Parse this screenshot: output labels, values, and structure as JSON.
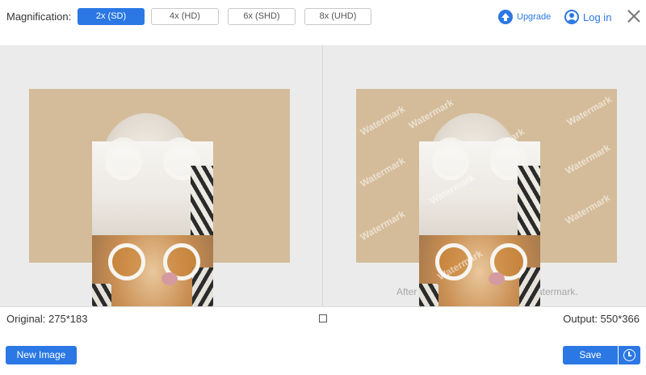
{
  "toolbar": {
    "magnification_label": "Magnification:",
    "options": [
      {
        "label": "2x (SD)",
        "selected": true
      },
      {
        "label": "4x (HD)",
        "selected": false
      },
      {
        "label": "6x (SHD)",
        "selected": false
      },
      {
        "label": "8x (UHD)",
        "selected": false
      }
    ],
    "upgrade_label": "Upgrade",
    "login_label": "Log in"
  },
  "preview": {
    "watermark_text": "Watermark",
    "caption_left": "After",
    "caption_right": "atermark."
  },
  "info": {
    "original": "Original: 275*183",
    "output": "Output: 550*366"
  },
  "bottom": {
    "new_image_label": "New Image",
    "save_label": "Save"
  },
  "colors": {
    "accent": "#2b78e4",
    "preview_background": "#ebebeb",
    "photo_background": "#d4bc9a"
  },
  "icons": {
    "upgrade": "upgrade-arrow-icon",
    "login": "user-icon",
    "close": "close-icon",
    "compare": "compare-icon",
    "history": "clock-icon"
  }
}
